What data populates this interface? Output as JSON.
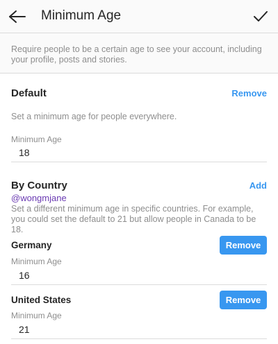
{
  "header": {
    "title": "Minimum Age",
    "back_icon": "arrow-left-icon",
    "confirm_icon": "checkmark-icon"
  },
  "intro": {
    "text": "Require people to be a certain age to see your account, including your profile, posts and stories."
  },
  "default_section": {
    "title": "Default",
    "action_label": "Remove",
    "description": "Set a minimum age for people everywhere.",
    "field_label": "Minimum Age",
    "field_value": "18"
  },
  "country_section": {
    "title": "By Country",
    "username": "@wongmjane",
    "action_label": "Add",
    "description": "Set a different minimum age in specific countries. For example, you could set the default to 21 but allow people in Canada to be 18.",
    "countries": [
      {
        "name": "Germany",
        "field_label": "Minimum Age",
        "value": "16",
        "remove_label": "Remove"
      },
      {
        "name": "United States",
        "field_label": "Minimum Age",
        "value": "21",
        "remove_label": "Remove"
      }
    ]
  },
  "colors": {
    "accent": "#3897f0",
    "username": "#6a3ab2",
    "secondary_text": "#8e8e8e",
    "primary_text": "#262626",
    "divider": "#dbdbdb"
  }
}
